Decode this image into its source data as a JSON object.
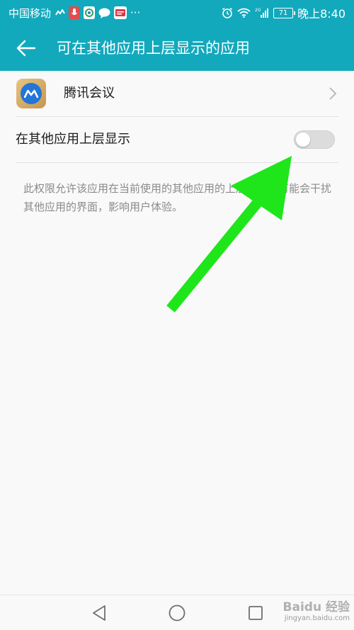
{
  "status_bar": {
    "carrier": "中国移动",
    "network_type": "2G",
    "battery_level": "71",
    "time": "晚上8:40",
    "more_indicator": "···",
    "icons": [
      "signal-wave-icon",
      "microphone-icon",
      "browser-app-icon",
      "chat-bubble-icon",
      "news-app-icon",
      "alarm-icon",
      "wifi-icon",
      "cell-signal-icon",
      "battery-icon"
    ]
  },
  "app_bar": {
    "title": "可在其他应用上层显示的应用",
    "back_icon": "arrow-left-icon"
  },
  "app_row": {
    "name": "腾讯会议",
    "icon": "tencent-meeting-app-icon",
    "chevron_icon": "chevron-right-icon"
  },
  "toggle_row": {
    "label": "在其他应用上层显示",
    "enabled": false
  },
  "description": {
    "text": "此权限允许该应用在当前使用的其他应用的上层显示，可能会干扰其他应用的界面，影响用户体验。"
  },
  "navigation": {
    "back_icon": "triangle-back-icon",
    "home_icon": "circle-home-icon",
    "recent_icon": "square-recents-icon"
  },
  "watermark": {
    "brand": "Baidu 经验",
    "url": "jingyan.baidu.com"
  },
  "colors": {
    "accent": "#12a9bd",
    "background": "#f9f9f9",
    "annotation_arrow": "#1ee61a",
    "secondary_text": "#8a8a8a"
  }
}
